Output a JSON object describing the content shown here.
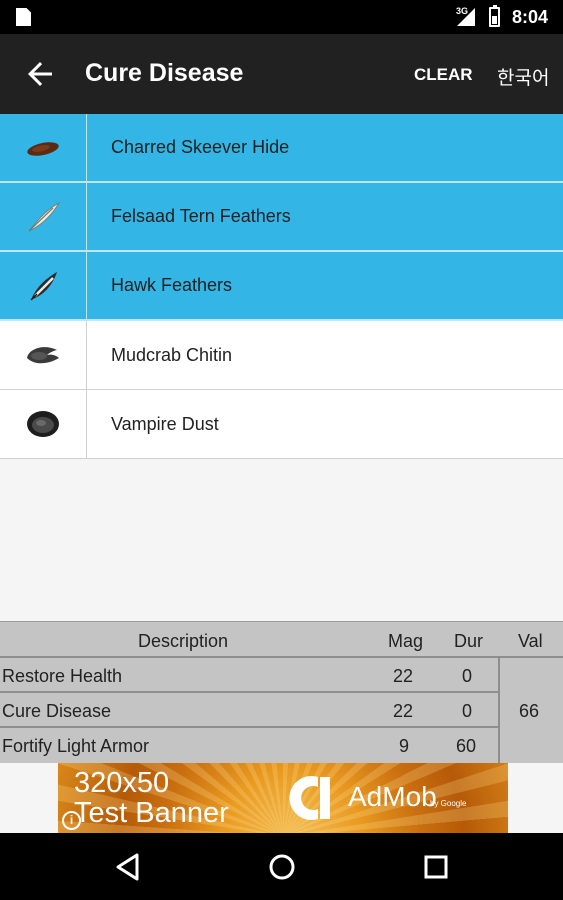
{
  "status_bar": {
    "network": "3G",
    "time": "8:04",
    "icons": [
      "sd-card-icon",
      "signal-icon",
      "battery-icon"
    ]
  },
  "app_bar": {
    "back_icon": "arrow-left-icon",
    "title": "Cure Disease",
    "clear_label": "CLEAR",
    "language_label": "한국어"
  },
  "ingredients": [
    {
      "name": "Charred Skeever Hide",
      "selected": true,
      "icon": "skeever-hide-icon"
    },
    {
      "name": "Felsaad Tern Feathers",
      "selected": true,
      "icon": "tern-feather-icon"
    },
    {
      "name": "Hawk Feathers",
      "selected": true,
      "icon": "hawk-feather-icon"
    },
    {
      "name": "Mudcrab Chitin",
      "selected": false,
      "icon": "mudcrab-chitin-icon"
    },
    {
      "name": "Vampire Dust",
      "selected": false,
      "icon": "vampire-dust-icon"
    }
  ],
  "effects_table": {
    "headers": {
      "description": "Description",
      "mag": "Mag",
      "dur": "Dur",
      "val": "Val"
    },
    "rows": [
      {
        "description": "Restore Health",
        "mag": "22",
        "dur": "0"
      },
      {
        "description": "Cure Disease",
        "mag": "22",
        "dur": "0"
      },
      {
        "description": "Fortify Light Armor",
        "mag": "9",
        "dur": "60"
      }
    ],
    "total_value": "66"
  },
  "ad_banner": {
    "line1": "320x50",
    "line2": "Test Banner",
    "brand": "AdMob",
    "brand_sub": "by Google",
    "info_icon": "i"
  },
  "nav_bar": {
    "icons": [
      "back-triangle-icon",
      "home-circle-icon",
      "recents-square-icon"
    ]
  },
  "colors": {
    "accent": "#33b5e5",
    "app_bar": "#212121",
    "table": "#c4c4c4"
  }
}
